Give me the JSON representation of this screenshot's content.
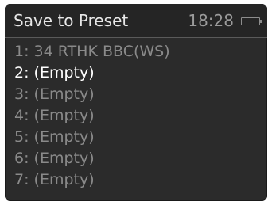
{
  "header": {
    "title": "Save to Preset",
    "time": "18:28",
    "battery_icon": "battery-icon"
  },
  "presets": [
    {
      "label": "1: 34 RTHK BBC(WS)",
      "selected": false
    },
    {
      "label": "2: (Empty)",
      "selected": true
    },
    {
      "label": "3: (Empty)",
      "selected": false
    },
    {
      "label": "4: (Empty)",
      "selected": false
    },
    {
      "label": "5: (Empty)",
      "selected": false
    },
    {
      "label": "6: (Empty)",
      "selected": false
    },
    {
      "label": "7: (Empty)",
      "selected": false
    }
  ],
  "colors": {
    "background": "#2b2b2b",
    "header_background": "#252525",
    "selected_text": "#ffffff",
    "unselected_text": "#8a8a8a"
  }
}
